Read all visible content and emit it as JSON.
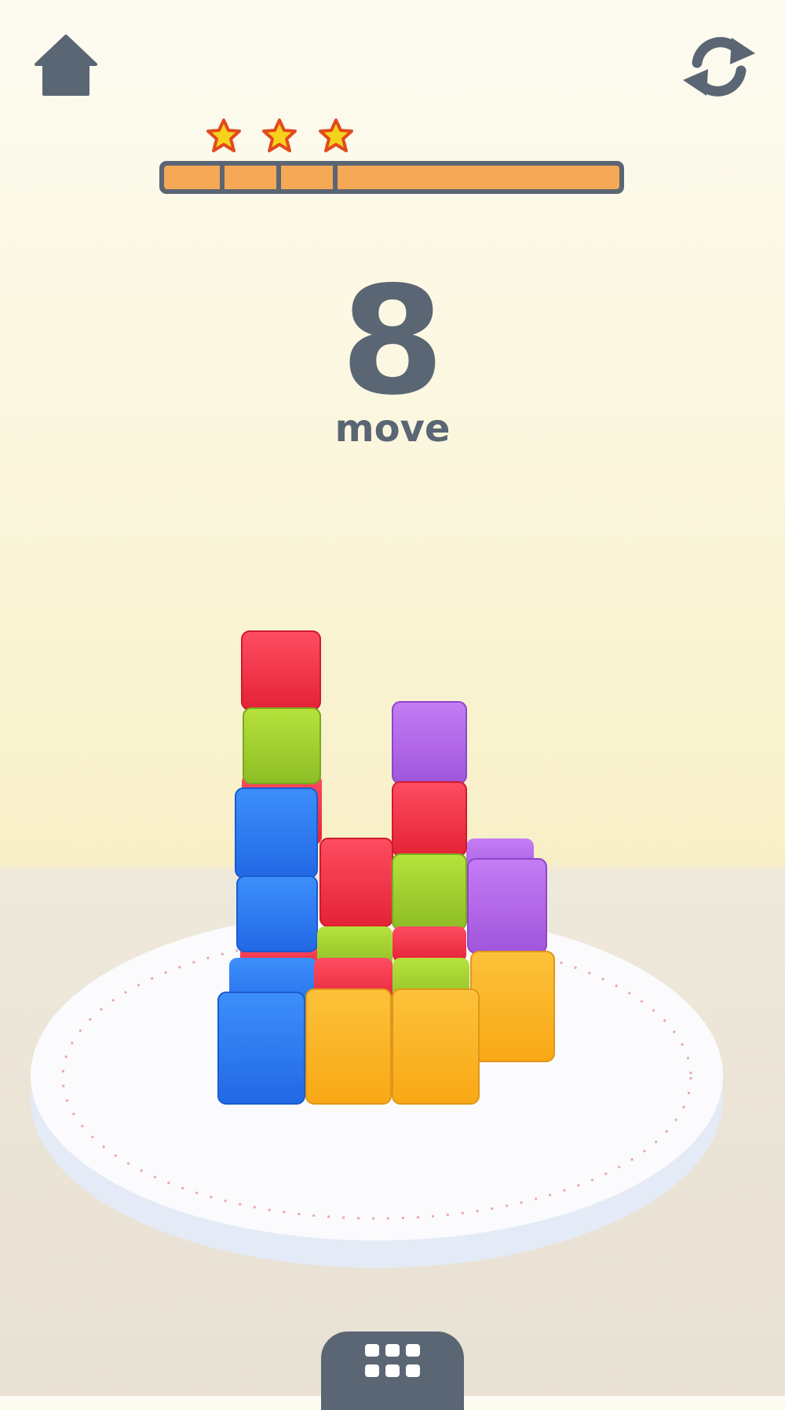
{
  "moves": {
    "count": "8",
    "label": "move"
  },
  "progress": {
    "fill_fraction": 1.0,
    "stars": 3,
    "star_segments": 3
  },
  "icons": {
    "home": "home-icon",
    "restart": "restart-icon",
    "menu": "grid-menu-icon",
    "star": "star-icon"
  },
  "colors": {
    "ui_dark": "#5b6674",
    "progress_fill": "#f5a855",
    "star_fill": "#f7d21c",
    "star_outline": "#e14a1e",
    "cube_red": "#f13046",
    "cube_green": "#9ed02c",
    "cube_blue": "#2f7ff0",
    "cube_purple": "#b468e6",
    "cube_yellow": "#fbb927"
  }
}
